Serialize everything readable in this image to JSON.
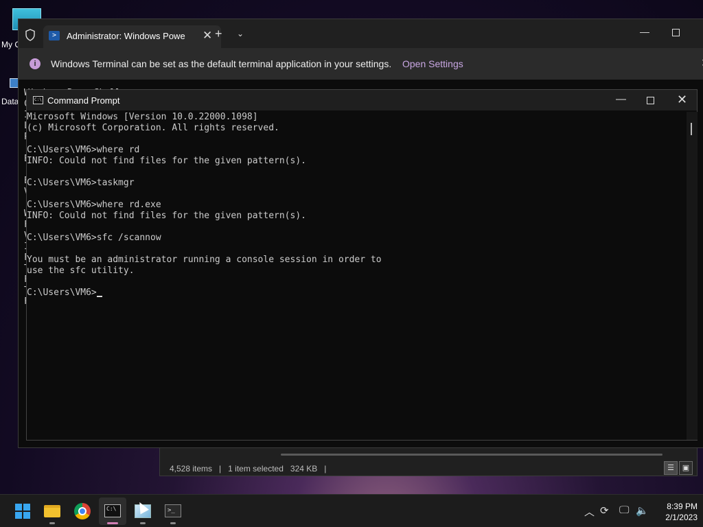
{
  "desktop": {
    "icons": [
      {
        "label": "My C"
      },
      {
        "label": "Data"
      }
    ]
  },
  "explorer": {
    "item_count": "4,528 items",
    "selection": "1 item selected",
    "size": "324 KB"
  },
  "terminal": {
    "tab_title": "Administrator: Windows Powe",
    "infobar_message": "Windows Terminal can be set as the default terminal application in your settings.",
    "infobar_link": "Open Settings",
    "background_text": [
      "Windows PowerShell",
      "C",
      "I",
      "L",
      "P",
      "",
      "E",
      "",
      "E",
      "V",
      "",
      "W",
      "F",
      "V",
      "I",
      "F",
      "T",
      "F",
      "T",
      "F"
    ]
  },
  "cmd": {
    "title": "Command Prompt",
    "lines": [
      "Microsoft Windows [Version 10.0.22000.1098]",
      "(c) Microsoft Corporation. All rights reserved.",
      "",
      "C:\\Users\\VM6>where rd",
      "INFO: Could not find files for the given pattern(s).",
      "",
      "C:\\Users\\VM6>taskmgr",
      "",
      "C:\\Users\\VM6>where rd.exe",
      "INFO: Could not find files for the given pattern(s).",
      "",
      "C:\\Users\\VM6>sfc /scannow",
      "",
      "You must be an administrator running a console session in order to",
      "use the sfc utility.",
      ""
    ],
    "prompt": "C:\\Users\\VM6>"
  },
  "taskbar": {
    "apps": [
      "start",
      "file-explorer",
      "chrome",
      "command-prompt",
      "image-viewer",
      "windows-terminal"
    ],
    "time": "8:39 PM",
    "date": "2/1/2023"
  }
}
